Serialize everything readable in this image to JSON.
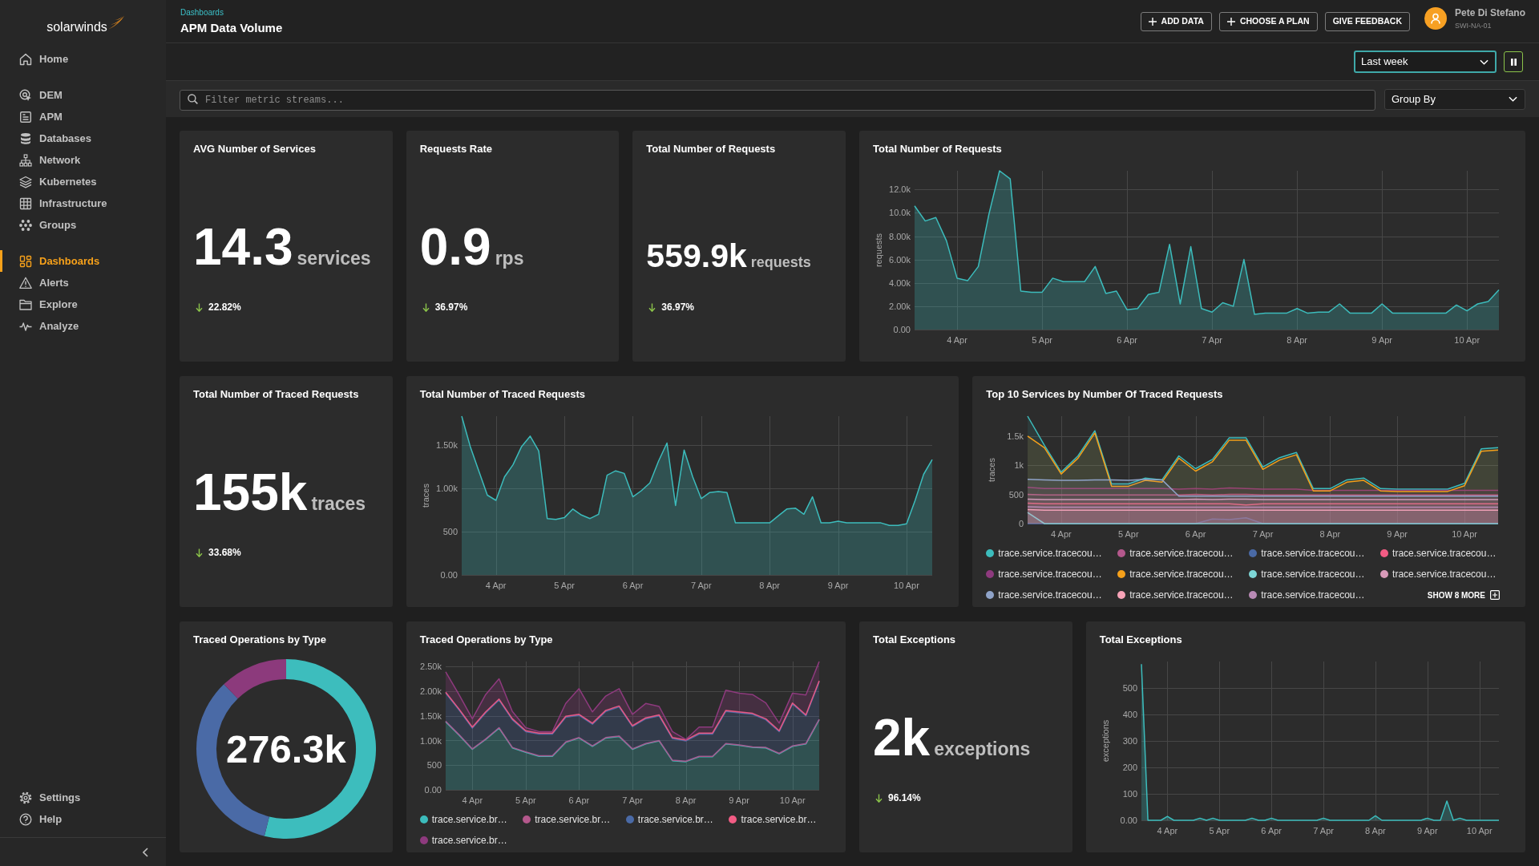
{
  "sidebar": {
    "logo": "solarwinds",
    "groups": [
      {
        "items": [
          {
            "label": "Home",
            "selected": false
          }
        ]
      },
      {
        "items": [
          {
            "label": "DEM",
            "selected": false
          },
          {
            "label": "APM",
            "selected": false
          },
          {
            "label": "Databases",
            "selected": false
          },
          {
            "label": "Network",
            "selected": false
          },
          {
            "label": "Kubernetes",
            "selected": false
          },
          {
            "label": "Infrastructure",
            "selected": false
          },
          {
            "label": "Groups",
            "selected": false
          }
        ]
      },
      {
        "items": [
          {
            "label": "Dashboards",
            "selected": true
          },
          {
            "label": "Alerts",
            "selected": false
          },
          {
            "label": "Explore",
            "selected": false
          },
          {
            "label": "Analyze",
            "selected": false
          }
        ]
      }
    ],
    "footer": [
      {
        "label": "Settings",
        "selected": false
      },
      {
        "label": "Help",
        "selected": false
      }
    ]
  },
  "header": {
    "breadcrumb": "Dashboards",
    "title": "APM Data Volume",
    "actions": [
      {
        "label": "ADD DATA",
        "kind": "add"
      },
      {
        "label": "CHOOSE A PLAN",
        "kind": "add"
      },
      {
        "label": "GIVE FEEDBACK",
        "kind": "plain"
      }
    ],
    "user": {
      "name": "Pete Di Stefano",
      "org": "SWI-NA-01"
    }
  },
  "toolbar": {
    "time_range": "Last week"
  },
  "filter": {
    "search": {
      "placeholder": "Filter metric streams..."
    },
    "group_by": "Group By"
  },
  "widgets": [
    {
      "kind": "kpi",
      "title": "AVG Number of Services",
      "value": "14.3",
      "unit": "services",
      "change": {
        "text": "22.82%",
        "decreased": true
      }
    },
    {
      "kind": "kpi",
      "title": "Requests Rate",
      "value": "0.9",
      "unit": "rps",
      "change": {
        "text": "36.97%",
        "decreased": true
      }
    },
    {
      "kind": "kpi",
      "title": "Total Number of Requests",
      "value": "559.9k",
      "unit": "requests",
      "change": {
        "text": "36.97%",
        "decreased": true
      }
    },
    {
      "kind": "chart",
      "title": "Total Number of Requests",
      "chart_data": {
        "type": "area",
        "ylabel": "requests",
        "grid": true,
        "ylim": [
          0,
          13600
        ],
        "yticks": [
          {
            "value": 0,
            "label": "0.00"
          },
          {
            "value": 2000,
            "label": "2.00k"
          },
          {
            "value": 4000,
            "label": "4.00k"
          },
          {
            "value": 6000,
            "label": "6.00k"
          },
          {
            "value": 8000,
            "label": "8.00k"
          },
          {
            "value": 10000,
            "label": "10.0k"
          },
          {
            "value": 12000,
            "label": "12.0k"
          }
        ],
        "categories": [
          null,
          null,
          null,
          null,
          "4 Apr",
          null,
          null,
          null,
          null,
          null,
          null,
          null,
          "5 Apr",
          null,
          null,
          null,
          null,
          null,
          null,
          null,
          "6 Apr",
          null,
          null,
          null,
          null,
          null,
          null,
          null,
          "7 Apr",
          null,
          null,
          null,
          null,
          null,
          null,
          null,
          "8 Apr",
          null,
          null,
          null,
          null,
          null,
          null,
          null,
          "9 Apr",
          null,
          null,
          null,
          null,
          null,
          null,
          null,
          "10 Apr",
          null,
          null,
          null
        ],
        "series": [
          {
            "color": "#3cbcbc",
            "values": [
              10600,
              9300,
              9600,
              7600,
              4400,
              4200,
              5400,
              9900,
              13600,
              12900,
              3300,
              3200,
              3200,
              4400,
              4100,
              4100,
              4100,
              5400,
              3100,
              3300,
              1700,
              1800,
              3000,
              3200,
              7300,
              2200,
              7100,
              1800,
              1500,
              2300,
              2000,
              6000,
              1300,
              1400,
              1400,
              1400,
              1800,
              1400,
              1500,
              1500,
              2200,
              1400,
              1400,
              1400,
              2200,
              1400,
              1400,
              1400,
              1400,
              1400,
              1400,
              2100,
              1600,
              2200,
              2400,
              3400
            ]
          }
        ]
      }
    },
    {
      "kind": "kpi",
      "title": "Total Number of Traced Requests",
      "value": "155k",
      "unit": "traces",
      "change": {
        "text": "33.68%",
        "decreased": true
      }
    },
    {
      "kind": "chart",
      "title": "Total Number of Traced Requests",
      "chart_data": {
        "type": "area",
        "ylabel": "traces",
        "grid": true,
        "ylim": [
          0,
          1830
        ],
        "yticks": [
          {
            "value": 0,
            "label": "0.00"
          },
          {
            "value": 500,
            "label": "500"
          },
          {
            "value": 1000,
            "label": "1.00k"
          },
          {
            "value": 1500,
            "label": "1.50k"
          }
        ],
        "categories": [
          null,
          null,
          null,
          null,
          "4 Apr",
          null,
          null,
          null,
          null,
          null,
          null,
          null,
          "5 Apr",
          null,
          null,
          null,
          null,
          null,
          null,
          null,
          "6 Apr",
          null,
          null,
          null,
          null,
          null,
          null,
          null,
          "7 Apr",
          null,
          null,
          null,
          null,
          null,
          null,
          null,
          "8 Apr",
          null,
          null,
          null,
          null,
          null,
          null,
          null,
          "9 Apr",
          null,
          null,
          null,
          null,
          null,
          null,
          null,
          "10 Apr",
          null,
          null,
          null
        ],
        "series": [
          {
            "color": "#3cbcbc",
            "values": [
              1830,
              1480,
              1200,
              920,
              860,
              1130,
              1270,
              1480,
              1600,
              1430,
              650,
              640,
              660,
              760,
              690,
              650,
              700,
              1150,
              1200,
              1170,
              900,
              970,
              1060,
              1310,
              1520,
              800,
              1440,
              1130,
              880,
              950,
              960,
              950,
              600,
              600,
              600,
              600,
              600,
              680,
              760,
              770,
              700,
              900,
              600,
              600,
              620,
              600,
              600,
              600,
              600,
              600,
              570,
              570,
              590,
              860,
              1160,
              1330
            ]
          }
        ]
      }
    },
    {
      "kind": "chart",
      "title": "Top 10 Services by Number Of Traced Requests",
      "show_more": "SHOW 8 MORE",
      "chart_data": {
        "type": "area",
        "ylabel": "traces",
        "grid": true,
        "ylim": [
          0,
          1840
        ],
        "yticks": [
          {
            "value": 0,
            "label": "0"
          },
          {
            "value": 500,
            "label": "500"
          },
          {
            "value": 1000,
            "label": "1k"
          },
          {
            "value": 1500,
            "label": "1.5k"
          }
        ],
        "categories": [
          null,
          null,
          "4 Apr",
          null,
          null,
          null,
          "5 Apr",
          null,
          null,
          null,
          "6 Apr",
          null,
          null,
          null,
          "7 Apr",
          null,
          null,
          null,
          "8 Apr",
          null,
          null,
          null,
          "9 Apr",
          null,
          null,
          null,
          "10 Apr",
          null,
          null
        ],
        "series": [
          {
            "name": "trace.service.tracecou…",
            "color": "#3cbcbc",
            "values": [
              1840,
              1340,
              880,
              1160,
              1590,
              680,
              680,
              780,
              750,
              1160,
              940,
              1100,
              1470,
              1470,
              970,
              1130,
              1220,
              600,
              600,
              750,
              780,
              600,
              590,
              590,
              590,
              590,
              690,
              1280,
              1300
            ]
          },
          {
            "name": "trace.service.tracecou…",
            "color": "#b4588c",
            "values": [
              500,
              490,
              490,
              490,
              490,
              490,
              490,
              490,
              490,
              490,
              500,
              490,
              500,
              500,
              490,
              490,
              490,
              490,
              490,
              490,
              490,
              490,
              490,
              490,
              490,
              490,
              490,
              490,
              490
            ]
          },
          {
            "name": "trace.service.tracecou…",
            "color": "#4a6aa6",
            "values": [
              0,
              0,
              0,
              0,
              0,
              0,
              0,
              0,
              0,
              0,
              0,
              80,
              70,
              100,
              0,
              0,
              0,
              0,
              0,
              0,
              0,
              0,
              0,
              0,
              0,
              0,
              0,
              0,
              0
            ]
          },
          {
            "name": "trace.service.tracecou…",
            "color": "#f25c84",
            "values": [
              350,
              340,
              340,
              340,
              340,
              340,
              340,
              340,
              340,
              340,
              340,
              340,
              340,
              320,
              340,
              340,
              340,
              340,
              340,
              340,
              340,
              340,
              340,
              340,
              340,
              340,
              340,
              340,
              340
            ]
          },
          {
            "name": "trace.service.tracecou…",
            "color": "#8e3a7e",
            "values": [
              620,
              600,
              600,
              600,
              600,
              600,
              600,
              600,
              600,
              590,
              600,
              590,
              610,
              600,
              590,
              590,
              590,
              570,
              570,
              570,
              570,
              570,
              570,
              570,
              570,
              570,
              570,
              570,
              570
            ]
          },
          {
            "name": "trace.service.tracecou…",
            "color": "#f5a01a",
            "values": [
              1500,
              1300,
              850,
              1120,
              1550,
              640,
              640,
              740,
              710,
              1120,
              900,
              1060,
              1430,
              1430,
              930,
              1090,
              1180,
              560,
              560,
              710,
              740,
              560,
              550,
              550,
              550,
              550,
              650,
              1240,
              1260
            ]
          },
          {
            "name": "trace.service.tracecou…",
            "color": "#7dd6d6",
            "values": [
              190,
              0,
              0,
              0,
              0,
              0,
              0,
              0,
              0,
              0,
              0,
              0,
              0,
              0,
              0,
              0,
              0,
              0,
              0,
              0,
              0,
              0,
              0,
              0,
              0,
              0,
              0,
              0,
              0
            ]
          },
          {
            "name": "trace.service.tracecou…",
            "color": "#d89ab8",
            "values": [
              420,
              410,
              410,
              410,
              410,
              410,
              410,
              410,
              410,
              410,
              420,
              410,
              420,
              420,
              410,
              410,
              410,
              410,
              410,
              410,
              410,
              410,
              410,
              410,
              410,
              410,
              410,
              410,
              410
            ]
          },
          {
            "name": "trace.service.tracecou…",
            "color": "#8fa3c8",
            "values": [
              760,
              750,
              740,
              740,
              750,
              750,
              740,
              760,
              750,
              470,
              470,
              470,
              470,
              470,
              470,
              470,
              470,
              470,
              470,
              470,
              470,
              470,
              470,
              470,
              470,
              470,
              470,
              470,
              470
            ]
          },
          {
            "name": "trace.service.tracecou…",
            "color": "#f7a3b7",
            "values": [
              240,
              230,
              230,
              230,
              230,
              230,
              230,
              230,
              230,
              230,
              230,
              230,
              230,
              230,
              230,
              230,
              230,
              230,
              230,
              230,
              230,
              230,
              230,
              230,
              230,
              230,
              230,
              230,
              230
            ]
          },
          {
            "name": "trace.service.tracecou…",
            "color": "#b98ab5",
            "values": [
              290,
              280,
              280,
              280,
              280,
              280,
              280,
              280,
              280,
              280,
              280,
              280,
              280,
              280,
              280,
              280,
              280,
              280,
              280,
              280,
              280,
              280,
              280,
              280,
              280,
              280,
              280,
              280,
              280
            ]
          }
        ]
      }
    },
    {
      "kind": "donut",
      "title": "Traced Operations by Type",
      "total": "276.3k",
      "chart_data": {
        "type": "donut",
        "categories": [
          null,
          null,
          null
        ],
        "values": [
          53.9,
          33.9,
          12.2
        ]
      }
    },
    {
      "kind": "chart",
      "title": "Traced Operations by Type",
      "chart_data": {
        "type": "area",
        "stacked": true,
        "grid": true,
        "ylim": [
          0,
          2600
        ],
        "yticks": [
          {
            "value": 0,
            "label": "0.00"
          },
          {
            "value": 500,
            "label": "500"
          },
          {
            "value": 1000,
            "label": "1.00k"
          },
          {
            "value": 1500,
            "label": "1.50k"
          },
          {
            "value": 2000,
            "label": "2.00k"
          },
          {
            "value": 2500,
            "label": "2.50k"
          }
        ],
        "categories": [
          null,
          null,
          "4 Apr",
          null,
          null,
          null,
          "5 Apr",
          null,
          null,
          null,
          "6 Apr",
          null,
          null,
          null,
          "7 Apr",
          null,
          null,
          null,
          "8 Apr",
          null,
          null,
          null,
          "9 Apr",
          null,
          null,
          null,
          "10 Apr",
          null,
          null
        ],
        "series": [
          {
            "name": "trace.service.br…",
            "color": "#3cbcbc",
            "values": [
              1380,
              1110,
              820,
              1020,
              1250,
              850,
              760,
              680,
              680,
              960,
              1050,
              880,
              1050,
              1080,
              820,
              930,
              990,
              590,
              570,
              670,
              670,
              930,
              900,
              860,
              850,
              730,
              880,
              930,
              1420
            ]
          },
          {
            "name": "trace.service.br…",
            "color": "#b4588c",
            "values": [
              10,
              10,
              10,
              10,
              10,
              10,
              10,
              10,
              10,
              10,
              10,
              10,
              10,
              10,
              10,
              10,
              10,
              10,
              10,
              10,
              10,
              10,
              10,
              10,
              10,
              10,
              10,
              10,
              10
            ]
          },
          {
            "name": "trace.service.br…",
            "color": "#4a6aa6",
            "values": [
              570,
              500,
              420,
              530,
              560,
              560,
              410,
              440,
              440,
              500,
              450,
              440,
              530,
              590,
              450,
              500,
              500,
              440,
              410,
              450,
              450,
              650,
              650,
              660,
              560,
              440,
              850,
              560,
              760
            ]
          },
          {
            "name": "trace.service.br…",
            "color": "#f25c84",
            "values": [
              20,
              20,
              20,
              20,
              20,
              20,
              20,
              20,
              20,
              20,
              20,
              20,
              20,
              20,
              20,
              20,
              20,
              20,
              20,
              20,
              20,
              20,
              20,
              20,
              20,
              20,
              20,
              20,
              20
            ]
          },
          {
            "name": "trace.service.br…",
            "color": "#8e3a7e",
            "values": [
              410,
              290,
              170,
              350,
              410,
              150,
              60,
              30,
              30,
              260,
              520,
              230,
              290,
              350,
              230,
              290,
              170,
              120,
              10,
              120,
              120,
              410,
              380,
              380,
              320,
              150,
              200,
              400,
              390
            ]
          }
        ]
      }
    },
    {
      "kind": "kpi",
      "title": "Total Exceptions",
      "value": "2k",
      "unit": "exceptions",
      "change": {
        "text": "96.14%",
        "decreased": true
      }
    },
    {
      "kind": "chart",
      "title": "Total Exceptions",
      "chart_data": {
        "type": "area",
        "ylabel": "exceptions",
        "grid": true,
        "ylim": [
          0,
          600
        ],
        "yticks": [
          {
            "value": 0,
            "label": "0.00"
          },
          {
            "value": 100,
            "label": "100"
          },
          {
            "value": 200,
            "label": "200"
          },
          {
            "value": 300,
            "label": "300"
          },
          {
            "value": 400,
            "label": "400"
          },
          {
            "value": 500,
            "label": "500"
          }
        ],
        "categories": [
          null,
          null,
          null,
          null,
          "4 Apr",
          null,
          null,
          null,
          null,
          null,
          null,
          null,
          "5 Apr",
          null,
          null,
          null,
          null,
          null,
          null,
          null,
          "6 Apr",
          null,
          null,
          null,
          null,
          null,
          null,
          null,
          "7 Apr",
          null,
          null,
          null,
          null,
          null,
          null,
          null,
          "8 Apr",
          null,
          null,
          null,
          null,
          null,
          null,
          null,
          "9 Apr",
          null,
          null,
          null,
          null,
          null,
          null,
          null,
          "10 Apr",
          null,
          null,
          null
        ],
        "series": [
          {
            "color": "#3cbcbc",
            "values": [
              590,
              0,
              0,
              0,
              15,
              0,
              0,
              0,
              0,
              8,
              0,
              8,
              0,
              0,
              0,
              0,
              0,
              8,
              0,
              0,
              8,
              0,
              0,
              0,
              0,
              0,
              0,
              0,
              8,
              0,
              0,
              0,
              0,
              0,
              0,
              0,
              17,
              0,
              0,
              0,
              0,
              0,
              0,
              0,
              8,
              0,
              0,
              73,
              0,
              8,
              0,
              0,
              0,
              0,
              0,
              0
            ]
          }
        ]
      }
    }
  ]
}
